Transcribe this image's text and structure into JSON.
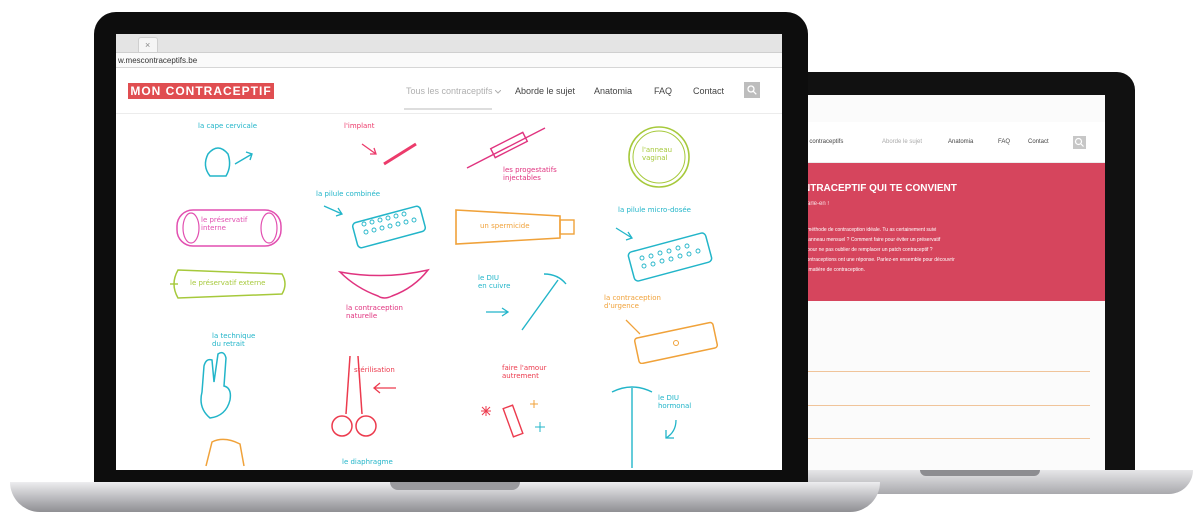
{
  "front": {
    "tab_close": "×",
    "url": "w.mescontraceptifs.be",
    "logo": "MON CONTRACEPTIF",
    "nav": [
      "Tous les contraceptifs",
      "Aborde le sujet",
      "Anatomia",
      "FAQ",
      "Contact"
    ],
    "search_icon": "search-icon",
    "doodles": [
      {
        "label": "la cape cervicale",
        "color": "#22b5c9"
      },
      {
        "label": "l'implant",
        "color": "#ec3b6b"
      },
      {
        "label": "les progestatifs\ninjectables",
        "color": "#e0337f"
      },
      {
        "label": "l'anneau\nvaginal",
        "color": "#a6c93b"
      },
      {
        "label": "la pilule combinée",
        "color": "#22b5c9"
      },
      {
        "label": "le préservatif\ninterne",
        "color": "#e24fb0"
      },
      {
        "label": "un spermicide",
        "color": "#f0a23a"
      },
      {
        "label": "la pilule micro-dosée",
        "color": "#22b5c9"
      },
      {
        "label": "le préservatif externe",
        "color": "#a6c93b"
      },
      {
        "label": "la contraception\nnaturelle",
        "color": "#e0337f"
      },
      {
        "label": "le DIU\nen cuivre",
        "color": "#22b5c9"
      },
      {
        "label": "la contraception\nd'urgence",
        "color": "#f0a23a"
      },
      {
        "label": "la technique\ndu retrait",
        "color": "#22b5c9"
      },
      {
        "label": "stérilisation",
        "color": "#ec3b4e"
      },
      {
        "label": "faire l'amour\nautrement",
        "color": "#ec3b4e"
      },
      {
        "label": "le DIU\nhormonal",
        "color": "#22b5c9"
      },
      {
        "label": "le diaphragme",
        "color": "#22b5c9"
      }
    ]
  },
  "back": {
    "nav": [
      "les contraceptifs",
      "Aborde le sujet",
      "Anatomia",
      "FAQ",
      "Contact"
    ],
    "hero_title": "NTRACEPTIF QUI TE CONVIENT",
    "hero_sub": "Parle-en !",
    "hero_text": [
      "a méthode de contraception idéale. Tu as certainement suivi",
      "in anneau mensuel ? Comment faire pour éviter un préservatif",
      "e pour ne pas oublier de remplacer un patch contraceptif ?",
      "Contraceptions ont une réponse. Parlez-en ensemble pour découvrir",
      "te matière de contraception."
    ]
  }
}
